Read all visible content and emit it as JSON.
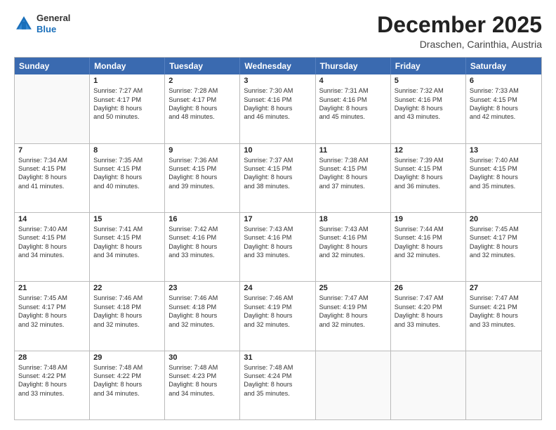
{
  "header": {
    "logo_general": "General",
    "logo_blue": "Blue",
    "month_title": "December 2025",
    "location": "Draschen, Carinthia, Austria"
  },
  "weekdays": [
    "Sunday",
    "Monday",
    "Tuesday",
    "Wednesday",
    "Thursday",
    "Friday",
    "Saturday"
  ],
  "rows": [
    [
      {
        "day": "",
        "sunrise": "",
        "sunset": "",
        "daylight": ""
      },
      {
        "day": "1",
        "sunrise": "Sunrise: 7:27 AM",
        "sunset": "Sunset: 4:17 PM",
        "daylight": "Daylight: 8 hours",
        "daylight2": "and 50 minutes."
      },
      {
        "day": "2",
        "sunrise": "Sunrise: 7:28 AM",
        "sunset": "Sunset: 4:17 PM",
        "daylight": "Daylight: 8 hours",
        "daylight2": "and 48 minutes."
      },
      {
        "day": "3",
        "sunrise": "Sunrise: 7:30 AM",
        "sunset": "Sunset: 4:16 PM",
        "daylight": "Daylight: 8 hours",
        "daylight2": "and 46 minutes."
      },
      {
        "day": "4",
        "sunrise": "Sunrise: 7:31 AM",
        "sunset": "Sunset: 4:16 PM",
        "daylight": "Daylight: 8 hours",
        "daylight2": "and 45 minutes."
      },
      {
        "day": "5",
        "sunrise": "Sunrise: 7:32 AM",
        "sunset": "Sunset: 4:16 PM",
        "daylight": "Daylight: 8 hours",
        "daylight2": "and 43 minutes."
      },
      {
        "day": "6",
        "sunrise": "Sunrise: 7:33 AM",
        "sunset": "Sunset: 4:15 PM",
        "daylight": "Daylight: 8 hours",
        "daylight2": "and 42 minutes."
      }
    ],
    [
      {
        "day": "7",
        "sunrise": "Sunrise: 7:34 AM",
        "sunset": "Sunset: 4:15 PM",
        "daylight": "Daylight: 8 hours",
        "daylight2": "and 41 minutes."
      },
      {
        "day": "8",
        "sunrise": "Sunrise: 7:35 AM",
        "sunset": "Sunset: 4:15 PM",
        "daylight": "Daylight: 8 hours",
        "daylight2": "and 40 minutes."
      },
      {
        "day": "9",
        "sunrise": "Sunrise: 7:36 AM",
        "sunset": "Sunset: 4:15 PM",
        "daylight": "Daylight: 8 hours",
        "daylight2": "and 39 minutes."
      },
      {
        "day": "10",
        "sunrise": "Sunrise: 7:37 AM",
        "sunset": "Sunset: 4:15 PM",
        "daylight": "Daylight: 8 hours",
        "daylight2": "and 38 minutes."
      },
      {
        "day": "11",
        "sunrise": "Sunrise: 7:38 AM",
        "sunset": "Sunset: 4:15 PM",
        "daylight": "Daylight: 8 hours",
        "daylight2": "and 37 minutes."
      },
      {
        "day": "12",
        "sunrise": "Sunrise: 7:39 AM",
        "sunset": "Sunset: 4:15 PM",
        "daylight": "Daylight: 8 hours",
        "daylight2": "and 36 minutes."
      },
      {
        "day": "13",
        "sunrise": "Sunrise: 7:40 AM",
        "sunset": "Sunset: 4:15 PM",
        "daylight": "Daylight: 8 hours",
        "daylight2": "and 35 minutes."
      }
    ],
    [
      {
        "day": "14",
        "sunrise": "Sunrise: 7:40 AM",
        "sunset": "Sunset: 4:15 PM",
        "daylight": "Daylight: 8 hours",
        "daylight2": "and 34 minutes."
      },
      {
        "day": "15",
        "sunrise": "Sunrise: 7:41 AM",
        "sunset": "Sunset: 4:15 PM",
        "daylight": "Daylight: 8 hours",
        "daylight2": "and 34 minutes."
      },
      {
        "day": "16",
        "sunrise": "Sunrise: 7:42 AM",
        "sunset": "Sunset: 4:16 PM",
        "daylight": "Daylight: 8 hours",
        "daylight2": "and 33 minutes."
      },
      {
        "day": "17",
        "sunrise": "Sunrise: 7:43 AM",
        "sunset": "Sunset: 4:16 PM",
        "daylight": "Daylight: 8 hours",
        "daylight2": "and 33 minutes."
      },
      {
        "day": "18",
        "sunrise": "Sunrise: 7:43 AM",
        "sunset": "Sunset: 4:16 PM",
        "daylight": "Daylight: 8 hours",
        "daylight2": "and 32 minutes."
      },
      {
        "day": "19",
        "sunrise": "Sunrise: 7:44 AM",
        "sunset": "Sunset: 4:16 PM",
        "daylight": "Daylight: 8 hours",
        "daylight2": "and 32 minutes."
      },
      {
        "day": "20",
        "sunrise": "Sunrise: 7:45 AM",
        "sunset": "Sunset: 4:17 PM",
        "daylight": "Daylight: 8 hours",
        "daylight2": "and 32 minutes."
      }
    ],
    [
      {
        "day": "21",
        "sunrise": "Sunrise: 7:45 AM",
        "sunset": "Sunset: 4:17 PM",
        "daylight": "Daylight: 8 hours",
        "daylight2": "and 32 minutes."
      },
      {
        "day": "22",
        "sunrise": "Sunrise: 7:46 AM",
        "sunset": "Sunset: 4:18 PM",
        "daylight": "Daylight: 8 hours",
        "daylight2": "and 32 minutes."
      },
      {
        "day": "23",
        "sunrise": "Sunrise: 7:46 AM",
        "sunset": "Sunset: 4:18 PM",
        "daylight": "Daylight: 8 hours",
        "daylight2": "and 32 minutes."
      },
      {
        "day": "24",
        "sunrise": "Sunrise: 7:46 AM",
        "sunset": "Sunset: 4:19 PM",
        "daylight": "Daylight: 8 hours",
        "daylight2": "and 32 minutes."
      },
      {
        "day": "25",
        "sunrise": "Sunrise: 7:47 AM",
        "sunset": "Sunset: 4:19 PM",
        "daylight": "Daylight: 8 hours",
        "daylight2": "and 32 minutes."
      },
      {
        "day": "26",
        "sunrise": "Sunrise: 7:47 AM",
        "sunset": "Sunset: 4:20 PM",
        "daylight": "Daylight: 8 hours",
        "daylight2": "and 33 minutes."
      },
      {
        "day": "27",
        "sunrise": "Sunrise: 7:47 AM",
        "sunset": "Sunset: 4:21 PM",
        "daylight": "Daylight: 8 hours",
        "daylight2": "and 33 minutes."
      }
    ],
    [
      {
        "day": "28",
        "sunrise": "Sunrise: 7:48 AM",
        "sunset": "Sunset: 4:22 PM",
        "daylight": "Daylight: 8 hours",
        "daylight2": "and 33 minutes."
      },
      {
        "day": "29",
        "sunrise": "Sunrise: 7:48 AM",
        "sunset": "Sunset: 4:22 PM",
        "daylight": "Daylight: 8 hours",
        "daylight2": "and 34 minutes."
      },
      {
        "day": "30",
        "sunrise": "Sunrise: 7:48 AM",
        "sunset": "Sunset: 4:23 PM",
        "daylight": "Daylight: 8 hours",
        "daylight2": "and 34 minutes."
      },
      {
        "day": "31",
        "sunrise": "Sunrise: 7:48 AM",
        "sunset": "Sunset: 4:24 PM",
        "daylight": "Daylight: 8 hours",
        "daylight2": "and 35 minutes."
      },
      {
        "day": "",
        "sunrise": "",
        "sunset": "",
        "daylight": "",
        "daylight2": ""
      },
      {
        "day": "",
        "sunrise": "",
        "sunset": "",
        "daylight": "",
        "daylight2": ""
      },
      {
        "day": "",
        "sunrise": "",
        "sunset": "",
        "daylight": "",
        "daylight2": ""
      }
    ]
  ]
}
